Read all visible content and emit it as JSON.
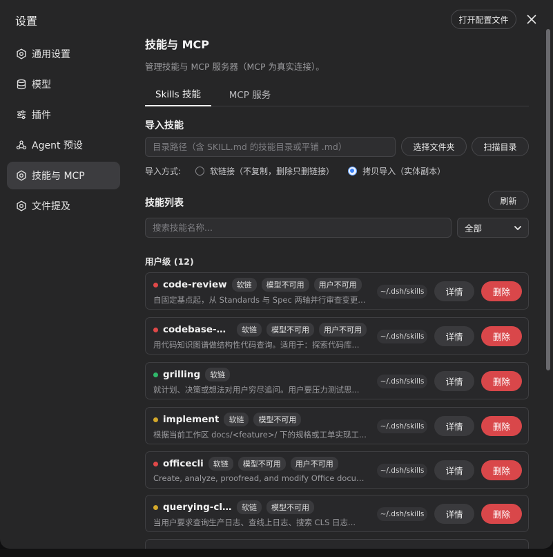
{
  "sidebar": {
    "title": "设置",
    "items": [
      {
        "label": "通用设置",
        "icon": "gear-icon"
      },
      {
        "label": "模型",
        "icon": "database-icon"
      },
      {
        "label": "插件",
        "icon": "sliders-icon"
      },
      {
        "label": "Agent 预设",
        "icon": "agent-icon"
      },
      {
        "label": "技能与 MCP",
        "icon": "gear-icon",
        "active": true
      },
      {
        "label": "文件提及",
        "icon": "gear-icon"
      }
    ]
  },
  "header": {
    "open_config_label": "打开配置文件",
    "close_icon": "close-icon"
  },
  "main": {
    "title": "技能与 MCP",
    "description": "管理技能与 MCP 服务器（MCP 为真实连接）。",
    "tabs": [
      {
        "label": "Skills 技能",
        "active": true
      },
      {
        "label": "MCP 服务",
        "active": false
      }
    ],
    "import": {
      "title": "导入技能",
      "path_placeholder": "目录路径（含 SKILL.md 的技能目录或平铺 .md）",
      "choose_folder_label": "选择文件夹",
      "scan_label": "扫描目录",
      "mode_label": "导入方式:",
      "mode_options": [
        {
          "label": "软链接（不复制，删除只删链接）",
          "checked": false
        },
        {
          "label": "拷贝导入（实体副本）",
          "checked": true
        }
      ]
    },
    "list": {
      "title": "技能列表",
      "refresh_label": "刷新",
      "search_placeholder": "搜索技能名称...",
      "filter_value": "全部",
      "group_label": "用户级 (12)",
      "skills": [
        {
          "name": "code-review",
          "status_color": "#e04848",
          "tags": [
            "软链",
            "模型不可用",
            "用户不可用"
          ],
          "description": "自固定基点起，从 Standards 与 Spec 两轴并行审查变更...",
          "path": "~/.dsh/skills",
          "detail_label": "详情",
          "delete_label": "删除"
        },
        {
          "name": "codebase-m...",
          "status_color": "#e04848",
          "tags": [
            "软链",
            "模型不可用",
            "用户不可用"
          ],
          "description": "用代码知识图谱做结构性代码查询。适用于：探索代码库...",
          "path": "~/.dsh/skills",
          "detail_label": "详情",
          "delete_label": "删除"
        },
        {
          "name": "grilling",
          "status_color": "#2fb86a",
          "tags": [
            "软链"
          ],
          "description": "就计划、决策或想法对用户穷尽追问。用户要压力测试思...",
          "path": "~/.dsh/skills",
          "detail_label": "详情",
          "delete_label": "删除"
        },
        {
          "name": "implement",
          "status_color": "#d4a82a",
          "tags": [
            "软链",
            "模型不可用"
          ],
          "description": "根据当前工作区 docs/<feature>/ 下的规格或工单实现工...",
          "path": "~/.dsh/skills",
          "detail_label": "详情",
          "delete_label": "删除"
        },
        {
          "name": "officecli",
          "status_color": "#e04848",
          "tags": [
            "软链",
            "模型不可用",
            "用户不可用"
          ],
          "description": "Create, analyze, proofread, and modify Office document...",
          "path": "~/.dsh/skills",
          "detail_label": "详情",
          "delete_label": "删除"
        },
        {
          "name": "querying-clis-logs",
          "status_color": "#d4a82a",
          "tags": [
            "软链",
            "模型不可用"
          ],
          "description": "当用户要求查询生产日志、查线上日志、搜索 CLS 日志...",
          "path": "~/.dsh/skills",
          "detail_label": "详情",
          "delete_label": "删除"
        }
      ]
    }
  }
}
